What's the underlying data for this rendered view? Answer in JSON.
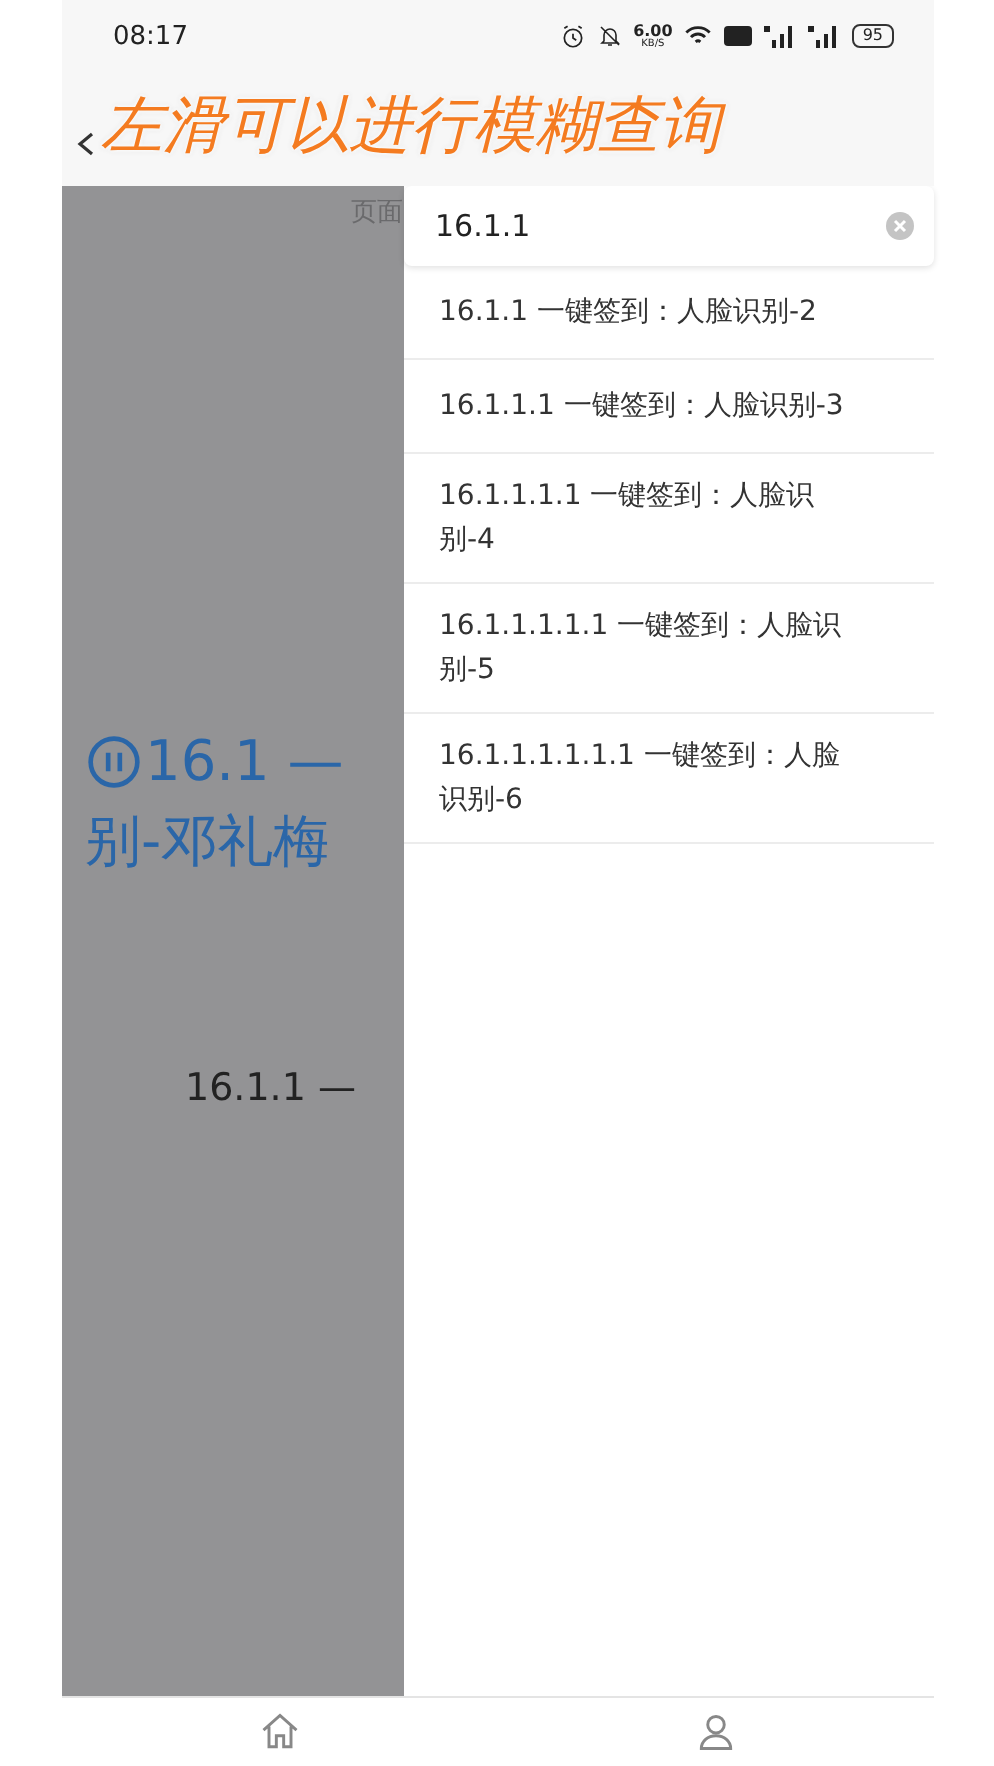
{
  "status_bar": {
    "time": "08:17",
    "speed": "6.00",
    "speed_unit": "KB/S",
    "battery": "95"
  },
  "banner": "左滑可以进行模糊查询",
  "page": {
    "subtitle": "页面",
    "heading_line_1": "16.1 —",
    "heading_line_2": "别-邓礼梅",
    "item": "16.1.1 —"
  },
  "search": {
    "value": "16.1.1"
  },
  "results": [
    {
      "label": "16.1.1 一键签到：人脸识别-2"
    },
    {
      "label": "16.1.1.1 一键签到：人脸识别-3"
    },
    {
      "label": "16.1.1.1.1 一键签到：人脸识别-4"
    },
    {
      "label": "16.1.1.1.1.1 一键签到：人脸识别-5"
    },
    {
      "label": "16.1.1.1.1.1.1 一键签到：人脸识别-6"
    }
  ],
  "nav": [
    {
      "kind": "home",
      "selected": false
    },
    {
      "kind": "profile",
      "selected": false
    }
  ]
}
